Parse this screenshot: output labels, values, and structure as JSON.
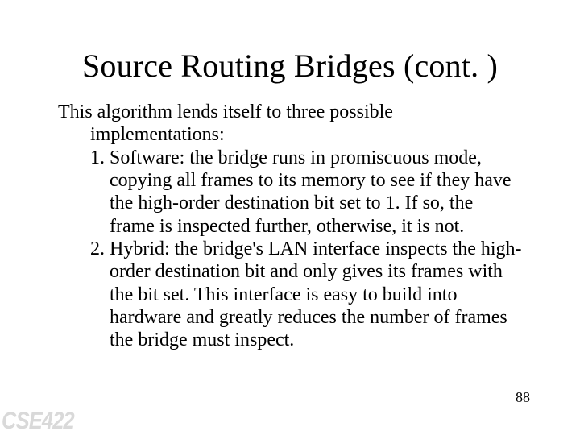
{
  "title": "Source Routing Bridges (cont. )",
  "lead": "This algorithm lends itself to three possible",
  "lead_cont": "implementations:",
  "item1": "1. Software:  the bridge runs in promiscuous mode, copying all frames to its memory to see if they have the high-order destination bit set to 1.  If so, the frame is inspected further, otherwise, it is not.",
  "item2": "2. Hybrid: the bridge's LAN interface inspects the high-order destination bit and only gives its frames with the bit set.  This interface is easy to build into hardware and greatly reduces the number of frames the bridge must inspect.",
  "page_number": "88",
  "course_code": "CSE422"
}
